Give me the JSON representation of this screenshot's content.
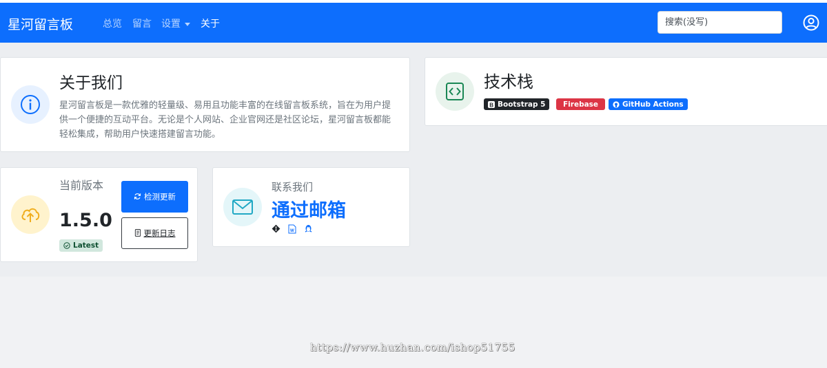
{
  "navbar": {
    "brand": "星河留言板",
    "links": [
      {
        "label": "总览"
      },
      {
        "label": "留言"
      },
      {
        "label": "设置"
      },
      {
        "label": "关于"
      }
    ],
    "search_placeholder": "搜索(没写)",
    "user_icon": "user-circle-icon"
  },
  "about": {
    "title": "关于我们",
    "text": "星河留言板是一款优雅的轻量级、易用且功能丰富的在线留言板系统，旨在为用户提供一个便捷的互动平台。无论是个人网站、企业官网还是社区论坛，星河留言板都能轻松集成，帮助用户快速搭建留言功能。",
    "icon": "info-circle-icon"
  },
  "tech": {
    "title": "技术栈",
    "icon": "code-icon",
    "badges": [
      {
        "label": "Bootstrap 5",
        "color": "#212529"
      },
      {
        "label": "Firebase",
        "color": "#dc3545"
      },
      {
        "label": "GitHub Actions",
        "color": "#0d6efd"
      }
    ]
  },
  "version": {
    "label": "当前版本",
    "number": "1.5.0",
    "status": "Latest",
    "check_button": "检测更新",
    "changelog_button": "更新日志",
    "icon": "cloud-upload-icon"
  },
  "contact": {
    "label": "联系我们",
    "headline": "通过邮箱",
    "icon": "envelope-icon",
    "links": [
      "git-icon",
      "word-icon",
      "qq-icon"
    ]
  },
  "watermark": "https://www.huzhan.com/ishop51755",
  "colors": {
    "primary": "#0d6efd",
    "warning_bg": "#fff3cd",
    "success_bg": "#d1e7dd",
    "info_bg": "#e7f1ff"
  }
}
